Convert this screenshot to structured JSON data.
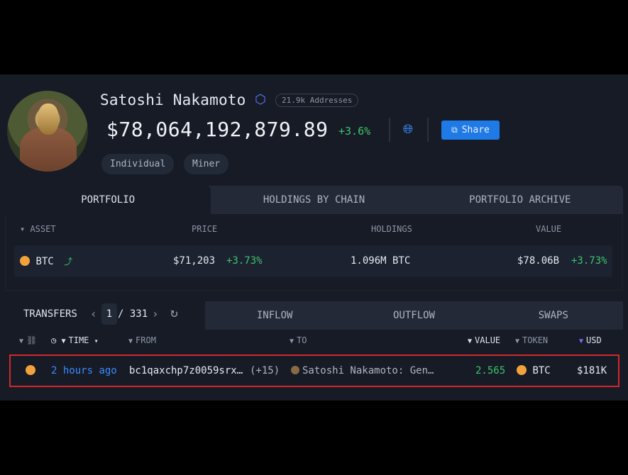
{
  "profile": {
    "name": "Satoshi Nakamoto",
    "addresses_badge": "21.9k Addresses",
    "balance": "$78,064,192,879.89",
    "balance_change": "+3.6%",
    "share_label": "Share",
    "tags": [
      "Individual",
      "Miner"
    ]
  },
  "tabs": [
    "PORTFOLIO",
    "HOLDINGS BY CHAIN",
    "PORTFOLIO ARCHIVE"
  ],
  "holdings": {
    "columns": [
      "ASSET",
      "PRICE",
      "HOLDINGS",
      "VALUE"
    ],
    "rows": [
      {
        "asset": "BTC",
        "price": "$71,203",
        "price_change": "+3.73%",
        "holdings": "1.096M BTC",
        "value": "$78.06B",
        "value_change": "+3.73%"
      }
    ]
  },
  "transfers": {
    "label": "TRANSFERS",
    "page_current": "1",
    "page_total": "/ 331",
    "flow_tabs": [
      "INFLOW",
      "OUTFLOW",
      "SWAPS"
    ],
    "columns": {
      "time": "TIME",
      "from": "FROM",
      "to": "TO",
      "value": "VALUE",
      "token": "TOKEN",
      "usd": "USD"
    },
    "rows": [
      {
        "time": "2 hours ago",
        "from": "bc1qaxchp7z0059srx…",
        "from_extra": "(+15)",
        "to": "Satoshi Nakamoto: Gen…",
        "value": "2.565",
        "token": "BTC",
        "usd": "$181K"
      }
    ]
  },
  "colors": {
    "accent": "#1f7ae6",
    "positive": "#3ec46d",
    "highlight": "#d3282c",
    "btc": "#f2a23a"
  }
}
